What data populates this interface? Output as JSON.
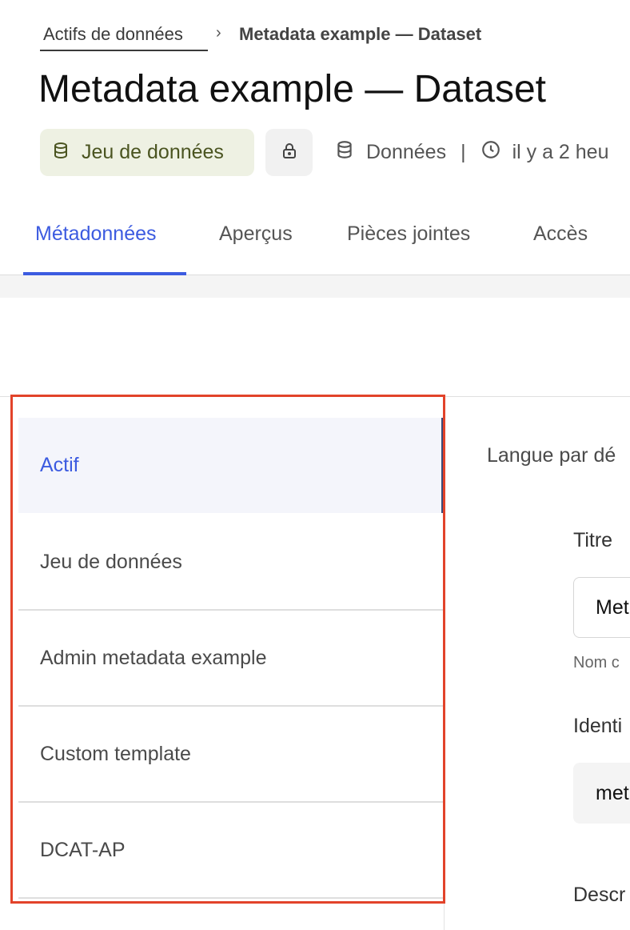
{
  "breadcrumb": {
    "parent": "Actifs de données",
    "separator": "›",
    "current": "Metadata example — Dataset"
  },
  "page_title": "Metadata example — Dataset",
  "badges": {
    "type_label": "Jeu de données",
    "type_icon": "database-icon",
    "lock_icon": "lock-icon",
    "source_label": "Données",
    "separator": "|",
    "time_label": "il y a 2 heu"
  },
  "tabs": [
    {
      "label": "Métadonnées",
      "active": true
    },
    {
      "label": "Aperçus",
      "active": false
    },
    {
      "label": "Pièces jointes",
      "active": false
    },
    {
      "label": "Accès",
      "active": false
    }
  ],
  "nav": [
    {
      "label": "Actif",
      "active": true
    },
    {
      "label": "Jeu de données",
      "active": false
    },
    {
      "label": "Admin metadata example",
      "active": false
    },
    {
      "label": "Custom template",
      "active": false
    },
    {
      "label": "DCAT-AP",
      "active": false
    }
  ],
  "form": {
    "default_language_label": "Langue par dé",
    "title_label": "Titre",
    "title_value": "Met",
    "title_help": "Nom c",
    "identifier_label": "Identi",
    "identifier_value": "met",
    "description_label": "Descr"
  },
  "colors": {
    "accent": "#3c5be0",
    "highlight": "#e2432a",
    "type_badge_bg": "#eef1e3"
  }
}
